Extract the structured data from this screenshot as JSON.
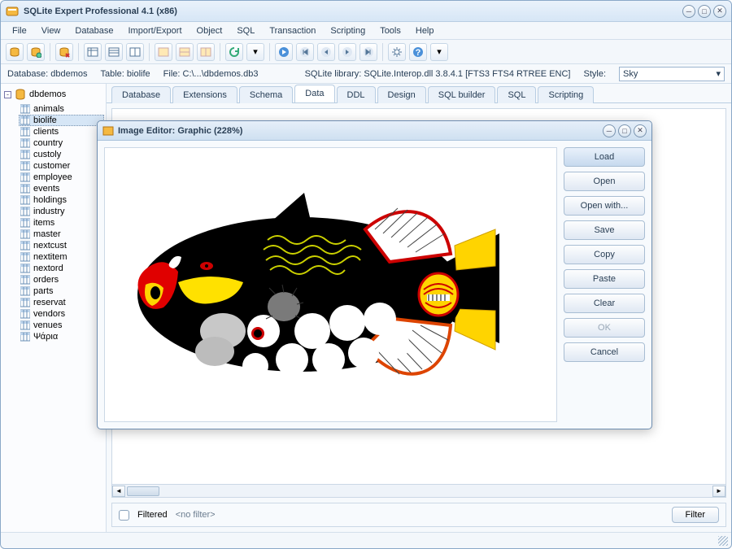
{
  "app": {
    "title": "SQLite Expert Professional 4.1 (x86)"
  },
  "menu": [
    "File",
    "View",
    "Database",
    "Import/Export",
    "Object",
    "SQL",
    "Transaction",
    "Scripting",
    "Tools",
    "Help"
  ],
  "info": {
    "db_label": "Database:",
    "db": "dbdemos",
    "table_label": "Table:",
    "table": "biolife",
    "file_label": "File:",
    "file": "C:\\...\\dbdemos.db3",
    "lib_label": "SQLite library:",
    "lib": "SQLite.Interop.dll 3.8.4.1 [FTS3 FTS4 RTREE ENC]",
    "style_label": "Style:",
    "style_value": "Sky"
  },
  "tree": {
    "root": "dbdemos",
    "tables": [
      "animals",
      "biolife",
      "clients",
      "country",
      "custoly",
      "customer",
      "employee",
      "events",
      "holdings",
      "industry",
      "items",
      "master",
      "nextcust",
      "nextitem",
      "nextord",
      "orders",
      "parts",
      "reservat",
      "vendors",
      "venues",
      "Ψάρια"
    ],
    "selected": "biolife"
  },
  "tabs": {
    "items": [
      "Database",
      "Extensions",
      "Schema",
      "Data",
      "DDL",
      "Design",
      "SQL builder",
      "SQL",
      "Scripting"
    ],
    "active": 3
  },
  "filter": {
    "checkbox_label": "Filtered",
    "text": "<no filter>",
    "button": "Filter"
  },
  "dialog": {
    "title": "Image Editor: Graphic (228%)",
    "buttons": [
      "Load",
      "Open",
      "Open with...",
      "Save",
      "Copy",
      "Paste",
      "Clear",
      "OK",
      "Cancel"
    ],
    "primary_index": 0,
    "disabled_index": 7
  }
}
